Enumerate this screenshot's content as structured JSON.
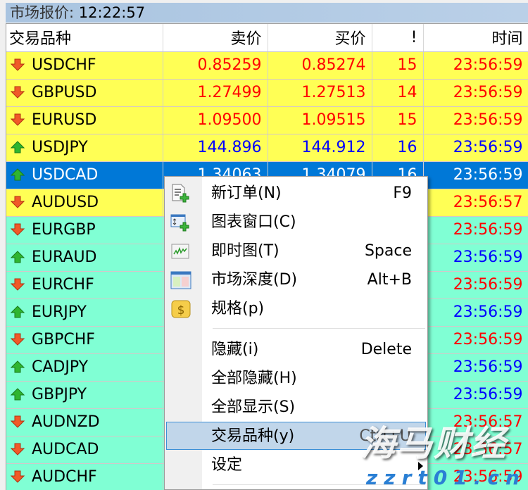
{
  "window": {
    "title_label": "市场报价:",
    "title_time": "12:22:57"
  },
  "columns": {
    "symbol": "交易品种",
    "bid": "卖价",
    "ask": "买价",
    "spread": "!",
    "time": "时间"
  },
  "rows": [
    {
      "symbol": "USDCHF",
      "dir": "down",
      "bid": "0.85259",
      "ask": "0.85274",
      "spread": "15",
      "time": "23:56:59",
      "bg": "yellow"
    },
    {
      "symbol": "GBPUSD",
      "dir": "down",
      "bid": "1.27499",
      "ask": "1.27513",
      "spread": "14",
      "time": "23:56:59",
      "bg": "yellow"
    },
    {
      "symbol": "EURUSD",
      "dir": "down",
      "bid": "1.09500",
      "ask": "1.09515",
      "spread": "15",
      "time": "23:56:59",
      "bg": "yellow"
    },
    {
      "symbol": "USDJPY",
      "dir": "up",
      "bid": "144.896",
      "ask": "144.912",
      "spread": "16",
      "time": "23:56:59",
      "bg": "yellow"
    },
    {
      "symbol": "USDCAD",
      "dir": "up",
      "bid": "1.34063",
      "ask": "1.34079",
      "spread": "16",
      "time": "23:56:59",
      "bg": "selected"
    },
    {
      "symbol": "AUDUSD",
      "dir": "down",
      "bid": "",
      "ask": "",
      "spread": "",
      "time": "23:56:57",
      "bg": "yellow"
    },
    {
      "symbol": "EURGBP",
      "dir": "down",
      "bid": "",
      "ask": "",
      "spread": "",
      "time": "23:56:59",
      "bg": "aqua"
    },
    {
      "symbol": "EURAUD",
      "dir": "up",
      "bid": "",
      "ask": "",
      "spread": "",
      "time": "23:56:59",
      "bg": "aqua"
    },
    {
      "symbol": "EURCHF",
      "dir": "down",
      "bid": "",
      "ask": "",
      "spread": "",
      "time": "23:56:59",
      "bg": "aqua"
    },
    {
      "symbol": "EURJPY",
      "dir": "up",
      "bid": "",
      "ask": "",
      "spread": "",
      "time": "23:56:59",
      "bg": "aqua"
    },
    {
      "symbol": "GBPCHF",
      "dir": "down",
      "bid": "",
      "ask": "",
      "spread": "",
      "time": "23:56:59",
      "bg": "aqua"
    },
    {
      "symbol": "CADJPY",
      "dir": "up",
      "bid": "",
      "ask": "",
      "spread": "",
      "time": "23:56:59",
      "bg": "aqua"
    },
    {
      "symbol": "GBPJPY",
      "dir": "up",
      "bid": "",
      "ask": "",
      "spread": "",
      "time": "23:56:59",
      "bg": "aqua"
    },
    {
      "symbol": "AUDNZD",
      "dir": "down",
      "bid": "",
      "ask": "",
      "spread": "",
      "time": "23:56:57",
      "bg": "aqua"
    },
    {
      "symbol": "AUDCAD",
      "dir": "down",
      "bid": "",
      "ask": "",
      "spread": "",
      "time": "23:56:57",
      "bg": "aqua"
    },
    {
      "symbol": "AUDCHF",
      "dir": "down",
      "bid": "",
      "ask": "",
      "spread": "",
      "time": "23:56:59",
      "bg": "aqua"
    }
  ],
  "context_menu": {
    "items": [
      {
        "label": "新订单(N)",
        "shortcut": "F9",
        "icon": "new-order-icon"
      },
      {
        "label": "图表窗口(C)",
        "shortcut": "",
        "icon": "chart-window-icon"
      },
      {
        "label": "即时图(T)",
        "shortcut": "Space",
        "icon": "tick-chart-icon"
      },
      {
        "label": "市场深度(D)",
        "shortcut": "Alt+B",
        "icon": "market-depth-icon"
      },
      {
        "label": "规格(p)",
        "shortcut": "",
        "icon": "specification-icon"
      },
      {
        "label": "隐藏(i)",
        "shortcut": "Delete"
      },
      {
        "label": "全部隐藏(H)",
        "shortcut": ""
      },
      {
        "label": "全部显示(S)",
        "shortcut": ""
      },
      {
        "label": "交易品种(y)",
        "shortcut": "Ctrl+U",
        "highlighted": true
      },
      {
        "label": "设定",
        "shortcut": "",
        "submenu": true
      }
    ]
  },
  "watermark": {
    "main": "海马财经",
    "url": "zzrt01.cn"
  },
  "colors": {
    "up": "#0000ff",
    "down": "#ff0000",
    "selected": "#0078d7",
    "yellow_row": "#ffff55",
    "aqua_row": "#80ffd4"
  }
}
